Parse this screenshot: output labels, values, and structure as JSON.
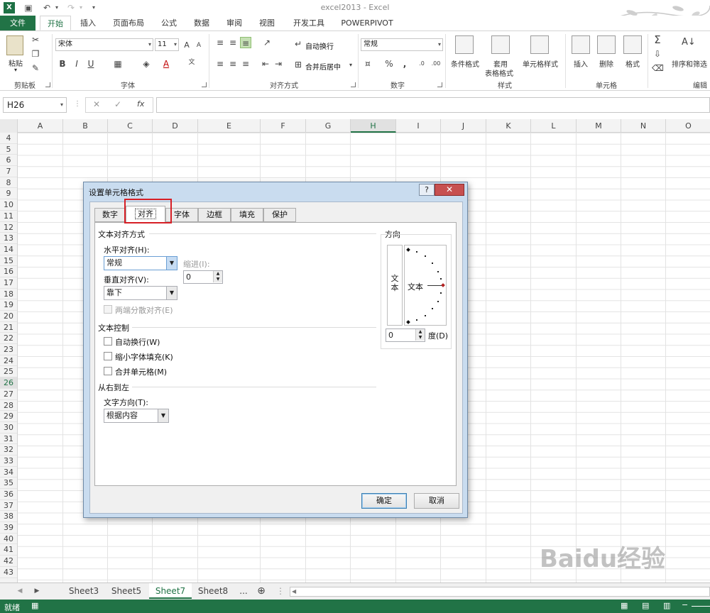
{
  "window": {
    "title": "excel2013 - Excel"
  },
  "ribbon_tabs": [
    "文件",
    "开始",
    "插入",
    "页面布局",
    "公式",
    "数据",
    "审阅",
    "视图",
    "开发工具",
    "POWERPIVOT"
  ],
  "ribbon": {
    "clipboard": {
      "label": "剪贴板",
      "paste": "粘贴"
    },
    "font": {
      "label": "字体",
      "name": "宋体",
      "size": "11",
      "bold": "B",
      "italic": "I",
      "underline": "U"
    },
    "alignment": {
      "label": "对齐方式",
      "wrap": "自动换行",
      "merge": "合并后居中"
    },
    "number": {
      "label": "数字",
      "format": "常规",
      "percent": "%"
    },
    "styles": {
      "label": "样式",
      "conditional": "条件格式",
      "table_format_1": "套用",
      "table_format_2": "表格格式",
      "cell_styles": "单元格样式"
    },
    "cells": {
      "label": "单元格",
      "insert": "插入",
      "delete": "删除",
      "format": "格式"
    },
    "editing": {
      "label": "编辑",
      "sort": "排序和筛选"
    }
  },
  "formula_bar": {
    "name_box": "H26",
    "fx": "fx"
  },
  "columns": [
    "A",
    "B",
    "C",
    "D",
    "E",
    "F",
    "G",
    "H",
    "I",
    "J",
    "K",
    "L",
    "M",
    "N",
    "O"
  ],
  "selected_column": "H",
  "rows": [
    "4",
    "5",
    "6",
    "7",
    "8",
    "9",
    "10",
    "11",
    "12",
    "13",
    "14",
    "15",
    "16",
    "17",
    "18",
    "19",
    "20",
    "21",
    "22",
    "23",
    "24",
    "25",
    "26",
    "27",
    "28",
    "29",
    "30",
    "31",
    "32",
    "33",
    "34",
    "35",
    "36",
    "37",
    "38",
    "39",
    "40",
    "41",
    "42",
    "43"
  ],
  "selected_row": "26",
  "sheets": [
    "Sheet3",
    "Sheet5",
    "Sheet7",
    "Sheet8",
    "..."
  ],
  "active_sheet": "Sheet7",
  "status": {
    "ready": "就绪"
  },
  "dialog": {
    "title": "设置单元格格式",
    "help": "?",
    "close": "✕",
    "tabs": [
      "数字",
      "对齐",
      "字体",
      "边框",
      "填充",
      "保护"
    ],
    "active_tab": "对齐",
    "text_align_section": "文本对齐方式",
    "horizontal_label": "水平对齐(H):",
    "horizontal_value": "常规",
    "indent_label": "缩进(I):",
    "indent_value": "0",
    "vertical_label": "垂直对齐(V):",
    "vertical_value": "靠下",
    "justify_distributed": "两端分散对齐(E)",
    "text_control_section": "文本控制",
    "wrap_text": "自动换行(W)",
    "shrink_to_fit": "缩小字体填充(K)",
    "merge_cells": "合并单元格(M)",
    "rtl_section": "从右到左",
    "text_direction_label": "文字方向(T):",
    "text_direction_value": "根据内容",
    "orientation_section": "方向",
    "vertical_text_1": "文",
    "vertical_text_2": "本",
    "dial_text": "文本",
    "degrees_value": "0",
    "degrees_label": "度(D)",
    "ok": "确定",
    "cancel": "取消"
  },
  "watermark": "Baidu经验"
}
